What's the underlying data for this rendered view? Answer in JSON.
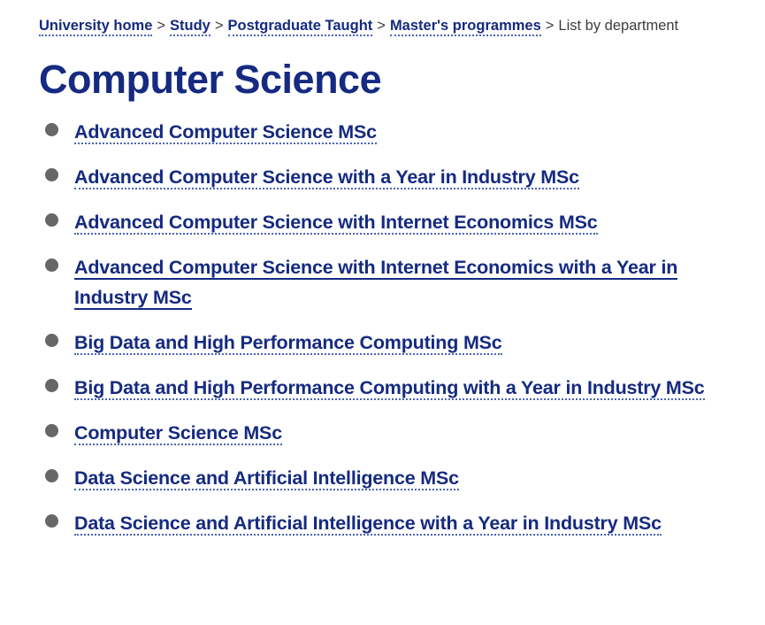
{
  "breadcrumb": {
    "separator": ">",
    "items": [
      {
        "label": "University home",
        "is_link": true
      },
      {
        "label": "Study",
        "is_link": true
      },
      {
        "label": "Postgraduate Taught",
        "is_link": true
      },
      {
        "label": "Master's programmes",
        "is_link": true
      },
      {
        "label": "List by department",
        "is_link": false
      }
    ]
  },
  "heading": {
    "title": "Computer Science"
  },
  "programmes": {
    "items": [
      {
        "label": "Advanced Computer Science MSc",
        "hovered": false
      },
      {
        "label": "Advanced Computer Science with a Year in Industry MSc",
        "hovered": false
      },
      {
        "label": "Advanced Computer Science with Internet Economics MSc",
        "hovered": false
      },
      {
        "label": "Advanced Computer Science with Internet Economics with a Year in Industry MSc",
        "hovered": true
      },
      {
        "label": "Big Data and High Performance Computing MSc",
        "hovered": false
      },
      {
        "label": "Big Data and High Performance Computing with a Year in Industry MSc",
        "hovered": false
      },
      {
        "label": "Computer Science MSc",
        "hovered": false
      },
      {
        "label": "Data Science and Artificial Intelligence MSc",
        "hovered": false
      },
      {
        "label": "Data Science and Artificial Intelligence with a Year in Industry MSc",
        "hovered": false
      }
    ]
  },
  "colors": {
    "brand_navy": "#152a80",
    "link_underline": "#4a63b8",
    "bullet_gray": "#676767",
    "body_text": "#3c3c3c",
    "background": "#ffffff"
  }
}
